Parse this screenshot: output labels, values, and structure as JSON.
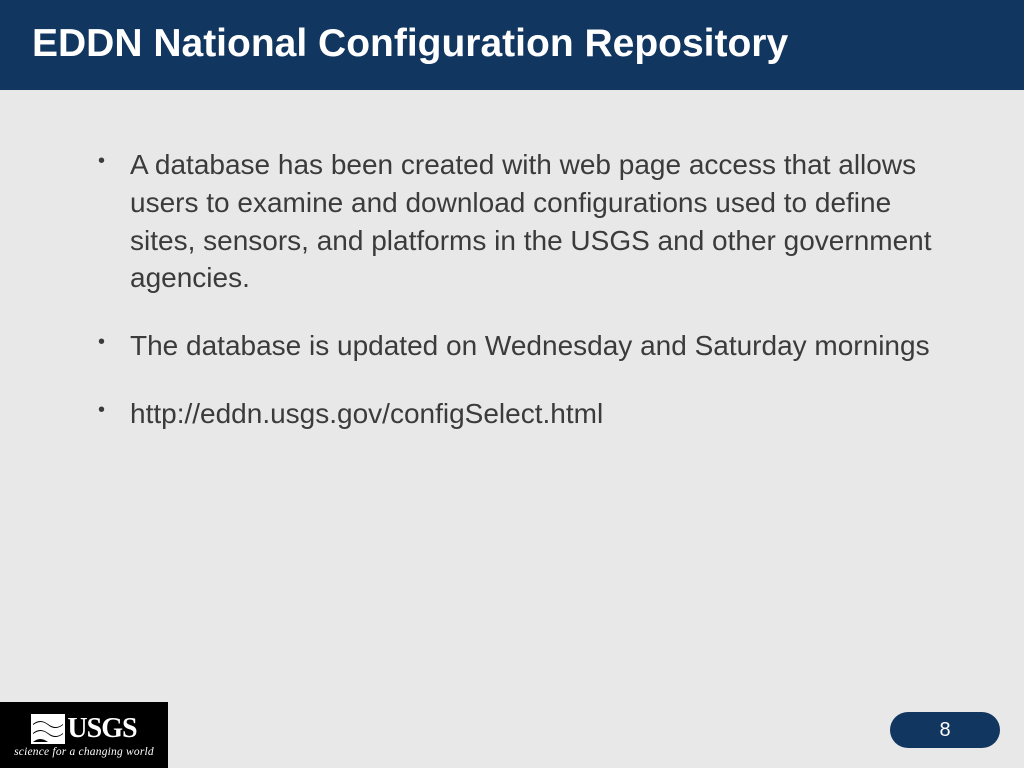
{
  "title": "EDDN National Configuration Repository",
  "bullets": [
    "A database has been created with web page access that allows users to examine and download configurations used to define sites, sensors, and platforms in the USGS and other government agencies.",
    "The database is updated on Wednesday and Saturday mornings",
    "http://eddn.usgs.gov/configSelect.html"
  ],
  "logo": {
    "name": "USGS",
    "tagline": "science for a changing world"
  },
  "page_number": "8"
}
